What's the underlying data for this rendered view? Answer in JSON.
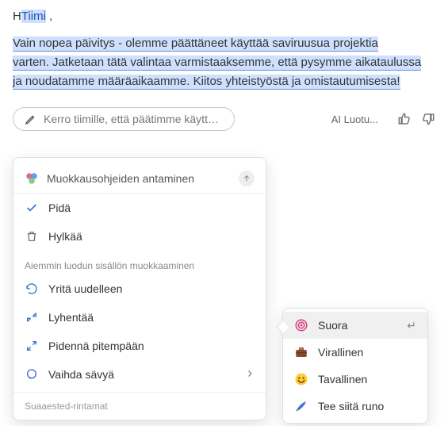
{
  "greeting": {
    "prefix": "H",
    "name": "Tiimi",
    "comma": ","
  },
  "body": {
    "line1": "Vain nopea päivitys - olemme päättäneet käyttää saviruusua projektia",
    "line2": "varten. Jatketaan tätä valintaa varmistaaksemme, että pysymme aikataulussa",
    "line3": "ja noudatamme määräaikaamme. Kiitos yhteistyöstä ja omistautumisesta!"
  },
  "prompt": {
    "placeholder": "Kerro tiimille, että päätimme käyttää...",
    "ai_label": "AI Luotu..."
  },
  "dropdown": {
    "header": "Muokkausohjeiden antaminen",
    "keep": "Pidä",
    "discard": "Hylkää",
    "section": "Aiemmin luodun sisällön muokkaaminen",
    "retry": "Yritä uudelleen",
    "shorten": "Lyhentää",
    "lengthen": "Pidennä pitempään",
    "tone": "Vaihda sävyä",
    "footer": "Suaaested-rintamat"
  },
  "submenu": {
    "direct": "Suora",
    "formal": "Virallinen",
    "casual": "Tavallinen",
    "poem": "Tee siitä runo"
  }
}
